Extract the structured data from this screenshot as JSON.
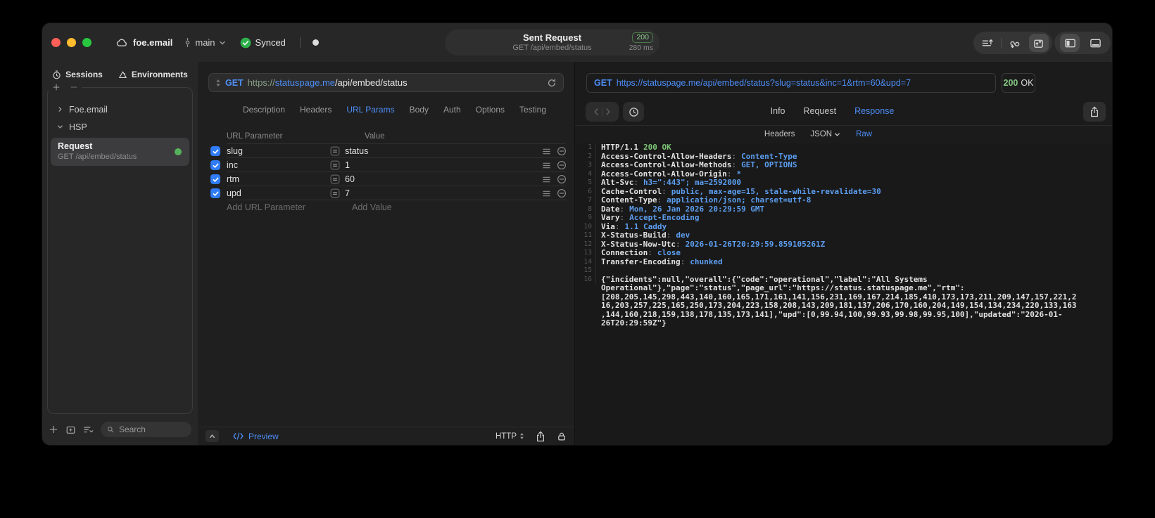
{
  "titlebar": {
    "project": "foe.email",
    "branch": "main",
    "sync_label": "Synced",
    "request_summary": {
      "title": "Sent Request",
      "subtitle": "GET /api/embed/status",
      "status_code": "200",
      "duration": "280 ms"
    }
  },
  "sidebar": {
    "tabs": [
      {
        "label": "Sessions"
      },
      {
        "label": "Environments"
      }
    ],
    "tree": [
      {
        "label": "Foe.email"
      },
      {
        "label": "HSP"
      }
    ],
    "request_item": {
      "title": "Request",
      "subtitle": "GET /api/embed/status"
    },
    "search_placeholder": "Search"
  },
  "request_editor": {
    "method": "GET",
    "url_scheme": "https://",
    "url_host": "statuspage.me",
    "url_path": "/api/embed/status",
    "tabs": [
      "Description",
      "Headers",
      "URL Params",
      "Body",
      "Auth",
      "Options",
      "Testing"
    ],
    "active_tab": "URL Params",
    "params_table": {
      "param_column": "URL Parameter",
      "value_column": "Value",
      "rows": [
        {
          "name": "slug",
          "value": "status",
          "enabled": true
        },
        {
          "name": "inc",
          "value": "1",
          "enabled": true
        },
        {
          "name": "rtm",
          "value": "60",
          "enabled": true
        },
        {
          "name": "upd",
          "value": "7",
          "enabled": true
        }
      ],
      "add_param_placeholder": "Add URL Parameter",
      "add_value_placeholder": "Add Value"
    },
    "footer": {
      "preview_label": "Preview",
      "protocol": "HTTP"
    }
  },
  "response_viewer": {
    "method": "GET",
    "url": "https://statuspage.me/api/embed/status?slug=status&inc=1&rtm=60&upd=7",
    "status_code": "200",
    "status_text": "OK",
    "tabs": [
      "Info",
      "Request",
      "Response"
    ],
    "active_tab": "Response",
    "view_tabs": [
      "Headers",
      "JSON",
      "Raw"
    ],
    "active_view": "Raw",
    "raw": {
      "status_line": {
        "line": "1",
        "protocol": "HTTP/1.1",
        "status": "200 OK"
      },
      "headers": [
        {
          "line": "2",
          "name": "Access-Control-Allow-Headers",
          "value": "Content-Type"
        },
        {
          "line": "3",
          "name": "Access-Control-Allow-Methods",
          "value": "GET, OPTIONS"
        },
        {
          "line": "4",
          "name": "Access-Control-Allow-Origin",
          "value": "*"
        },
        {
          "line": "5",
          "name": "Alt-Svc",
          "value": "h3=\":443\"; ma=2592000"
        },
        {
          "line": "6",
          "name": "Cache-Control",
          "value": "public, max-age=15, stale-while-revalidate=30"
        },
        {
          "line": "7",
          "name": "Content-Type",
          "value": "application/json; charset=utf-8"
        },
        {
          "line": "8",
          "name": "Date",
          "value": "Mon, 26 Jan 2026 20:29:59 GMT"
        },
        {
          "line": "9",
          "name": "Vary",
          "value": "Accept-Encoding"
        },
        {
          "line": "10",
          "name": "Via",
          "value": "1.1 Caddy"
        },
        {
          "line": "11",
          "name": "X-Status-Build",
          "value": "dev"
        },
        {
          "line": "12",
          "name": "X-Status-Now-Utc",
          "value": "2026-01-26T20:29:59.859105261Z"
        },
        {
          "line": "13",
          "name": "Connection",
          "value": "close"
        },
        {
          "line": "14",
          "name": "Transfer-Encoding",
          "value": "chunked"
        }
      ],
      "blank_line": "15",
      "body_line": "16",
      "body": "{\"incidents\":null,\"overall\":{\"code\":\"operational\",\"label\":\"All Systems Operational\"},\"page\":\"status\",\"page_url\":\"https://status.statuspage.me\",\"rtm\":[208,205,145,298,443,140,160,165,171,161,141,156,231,169,167,214,185,410,173,173,211,209,147,157,221,216,203,257,225,165,250,173,204,223,158,208,143,209,181,137,206,170,160,204,149,154,134,234,220,133,163,144,160,218,159,138,178,135,173,141],\"upd\":[0,99.94,100,99.93,99.98,99.95,100],\"updated\":\"2026-01-26T20:29:59Z\"}"
    }
  },
  "colors": {
    "accent_blue": "#4d8df6",
    "status_green": "#7cc576",
    "checkbox_blue": "#2f7cf6",
    "badge_green": "#8ecb8e"
  }
}
